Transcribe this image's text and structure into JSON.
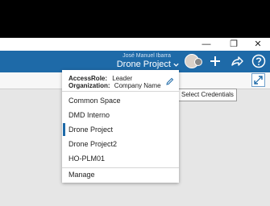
{
  "header": {
    "user_name": "José Manuel Ibarra",
    "project_name": "Drone Project"
  },
  "window": {
    "minimize": "—",
    "restore": "❐",
    "close": "✕"
  },
  "credentials": {
    "access_role_label": "AccessRole:",
    "access_role_value": "Leader",
    "organization_label": "Organization:",
    "organization_value": "Company Name"
  },
  "menu": {
    "items": [
      {
        "label": "Common Space"
      },
      {
        "label": "DMD Interno"
      },
      {
        "label": "Drone Project",
        "active": true
      },
      {
        "label": "Drone Project2"
      },
      {
        "label": "HO-PLM01"
      }
    ],
    "manage_label": "Manage"
  },
  "tooltip": {
    "text": "Select Credentials"
  },
  "icons": {
    "chevron": "chevron-down-icon",
    "add": "plus-icon",
    "share": "share-icon",
    "help": "help-icon",
    "edit": "pencil-icon",
    "expand": "expand-icon"
  },
  "colors": {
    "brand_blue": "#1e6aa8",
    "active_indicator": "#1e6aa8"
  }
}
